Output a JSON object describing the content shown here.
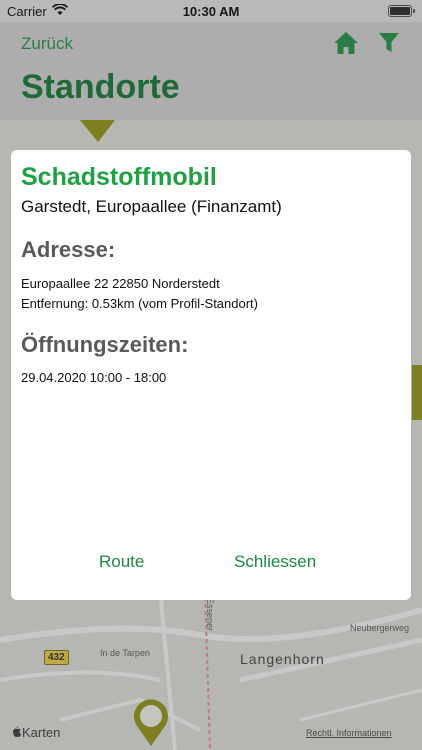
{
  "status_bar": {
    "carrier": "Carrier",
    "time": "10:30 AM"
  },
  "nav": {
    "back_label": "Zurück",
    "title": "Standorte",
    "home_icon": "home-icon",
    "filter_icon": "filter-icon"
  },
  "map": {
    "district": "Langenhorn",
    "road_number": "432",
    "streets": [
      "In de Tarpen",
      "Essener",
      "Neubergerweg"
    ],
    "attribution": "Rechtl. Informationen",
    "maps_logo": "Karten"
  },
  "dialog": {
    "heading": "Schadstoffmobil",
    "subtitle": "Garstedt, Europaallee (Finanzamt)",
    "address_heading": "Adresse:",
    "address_line": "Europaallee 22 22850 Norderstedt",
    "distance_line": "Entfernung: 0.53km (vom Profil-Standort)",
    "hours_heading": "Öffnungszeiten:",
    "hours_line": "29.04.2020 10:00 - 18:00",
    "route_label": "Route",
    "close_label": "Schliessen"
  },
  "colors": {
    "accent": "#1ea043",
    "title_green": "#0d6f2e",
    "marker": "#8a8a10"
  }
}
